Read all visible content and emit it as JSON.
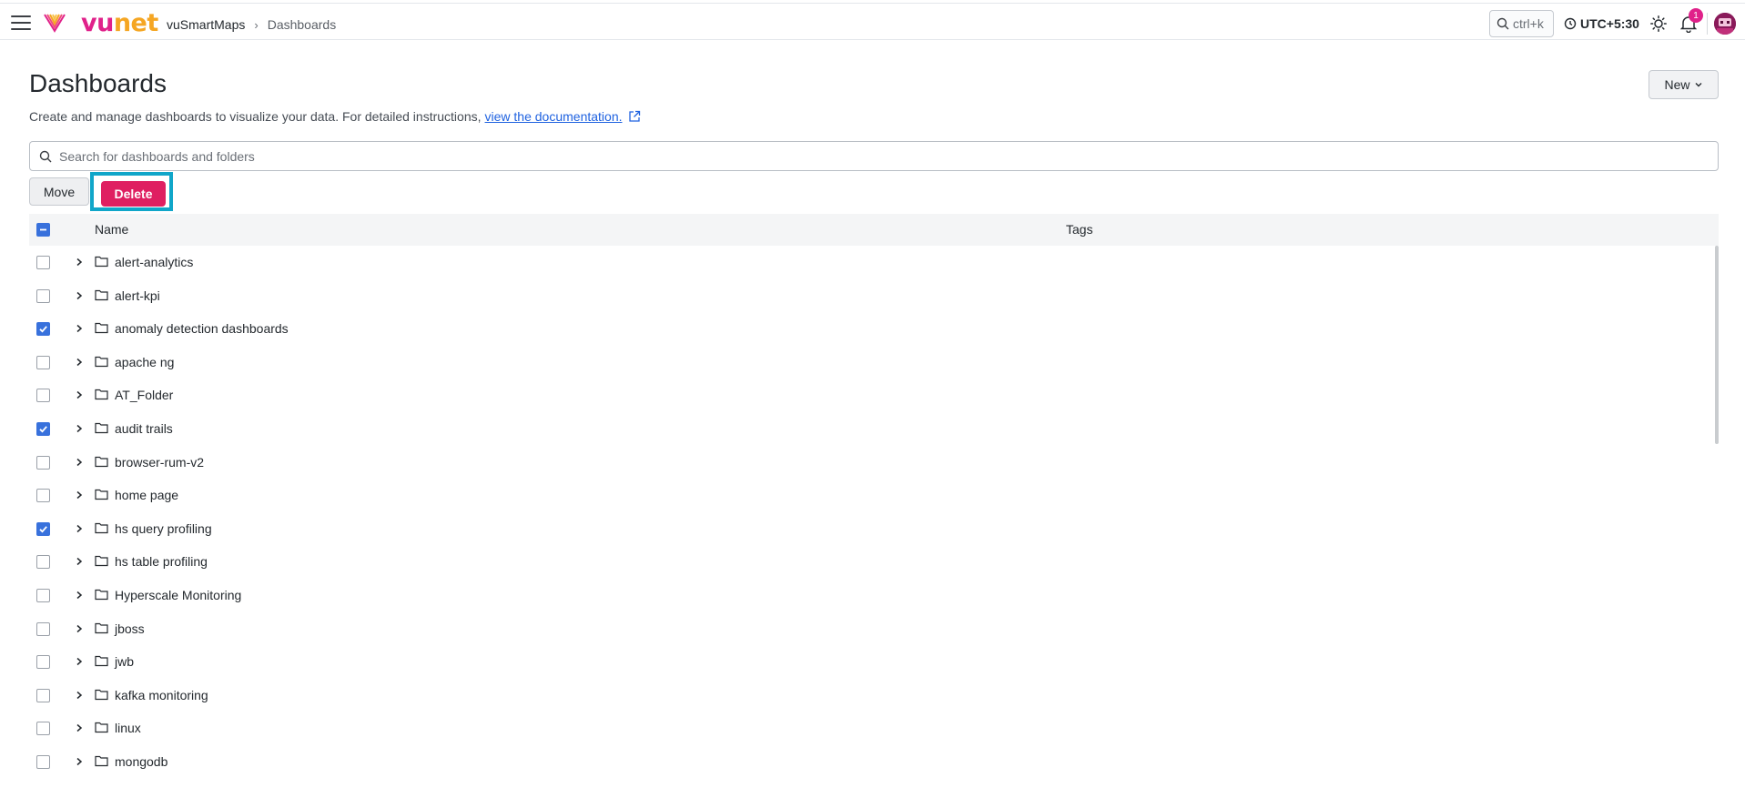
{
  "header": {
    "brand_vu": "vu",
    "brand_net": "net",
    "breadcrumb": [
      "vuSmartMaps",
      "Dashboards"
    ],
    "search_shortcut": "ctrl+k",
    "timezone": "UTC+5:30",
    "notification_count": "1",
    "accent_color": "#e0218a"
  },
  "page": {
    "title": "Dashboards",
    "description": "Create and manage dashboards to visualize your data. For detailed instructions,",
    "doc_link": "view the documentation.",
    "new_label": "New",
    "search_placeholder": "Search for dashboards and folders",
    "move_label": "Move",
    "delete_label": "Delete"
  },
  "table": {
    "columns": {
      "name": "Name",
      "tags": "Tags"
    },
    "rows": [
      {
        "name": "alert-analytics",
        "checked": false
      },
      {
        "name": "alert-kpi",
        "checked": false
      },
      {
        "name": "anomaly detection dashboards",
        "checked": true
      },
      {
        "name": "apache ng",
        "checked": false
      },
      {
        "name": "AT_Folder",
        "checked": false
      },
      {
        "name": "audit trails",
        "checked": true
      },
      {
        "name": "browser-rum-v2",
        "checked": false
      },
      {
        "name": "home page",
        "checked": false
      },
      {
        "name": "hs query profiling",
        "checked": true
      },
      {
        "name": "hs table profiling",
        "checked": false
      },
      {
        "name": "Hyperscale Monitoring",
        "checked": false
      },
      {
        "name": "jboss",
        "checked": false
      },
      {
        "name": "jwb",
        "checked": false
      },
      {
        "name": "kafka monitoring",
        "checked": false
      },
      {
        "name": "linux",
        "checked": false
      },
      {
        "name": "mongodb",
        "checked": false
      }
    ]
  }
}
